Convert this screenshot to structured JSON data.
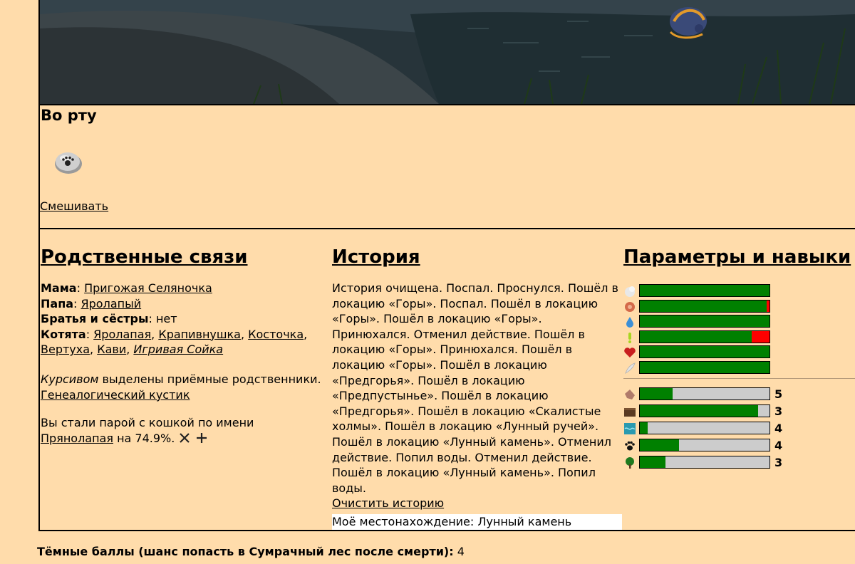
{
  "mouth": {
    "title": "Во рту",
    "item_icon": "stone-with-paw-icon",
    "mix_label": "Смешивать"
  },
  "relatives": {
    "title": "Родственные связи",
    "mother_label": "Мама",
    "mother": "Пригожая Селяночка",
    "father_label": "Папа",
    "father": "Яролапый",
    "siblings_label": "Братья и сёстры",
    "siblings": "нет",
    "kittens_label": "Котята",
    "kittens": [
      "Яролапая",
      "Крапивнушка",
      "Косточка",
      "Вертуха",
      "Кави",
      "Игривая Сойка"
    ],
    "note_italic": "Курсивом",
    "note_rest": " выделены приёмные родственники.",
    "tree_link": "Генеалогический кустик",
    "pair_text": "Вы стали парой с кошкой по имени",
    "pair_name": "Прянолапая",
    "pair_percent": " на 74.9%."
  },
  "history": {
    "title": "История",
    "text": "История очищена. Поспал. Проснулся. Пошёл в локацию «Горы». Поспал. Пошёл в локацию «Горы». Пошёл в локацию «Горы». Принюхался. Отменил действие. Пошёл в локацию «Горы». Принюхался. Пошёл в локацию «Горы». Пошёл в локацию «Предгорья». Пошёл в локацию «Предпустынье». Пошёл в локацию «Предгорья». Пошёл в локацию «Скалистые холмы». Пошёл в локацию «Лунный ручей». Пошёл в локацию «Лунный камень». Отменил действие. Попил воды. Отменил действие. Пошёл в локацию «Лунный камень». Попил воды.",
    "clear_link": "Очистить историю",
    "location": "Моё местонахождение: Лунный камень"
  },
  "params": {
    "title": "Параметры и навыки",
    "colors": {
      "fill": "#008000",
      "deficit": "#ff0000",
      "empty": "#cccccc"
    },
    "stats": [
      {
        "icon": "sleep-icon",
        "level": 1.0
      },
      {
        "icon": "meat-icon",
        "level": 0.98
      },
      {
        "icon": "water-drop-icon",
        "level": 1.0
      },
      {
        "icon": "need-exclamation-icon",
        "level": 0.86
      },
      {
        "icon": "heart-icon",
        "level": 1.0
      },
      {
        "icon": "feather-icon",
        "level": 1.0
      }
    ],
    "skills": [
      {
        "icon": "sniff-icon",
        "level": 0.25,
        "value": "5"
      },
      {
        "icon": "dig-icon",
        "level": 0.91,
        "value": "3"
      },
      {
        "icon": "swim-icon",
        "level": 0.06,
        "value": "4"
      },
      {
        "icon": "paw-icon",
        "level": 0.3,
        "value": "4"
      },
      {
        "icon": "tree-icon",
        "level": 0.2,
        "value": "3"
      }
    ]
  },
  "footer": {
    "dark_points_label": "Тёмные баллы (шанс попасть в Сумрачный лес после смерти):",
    "dark_points_value": "4"
  }
}
